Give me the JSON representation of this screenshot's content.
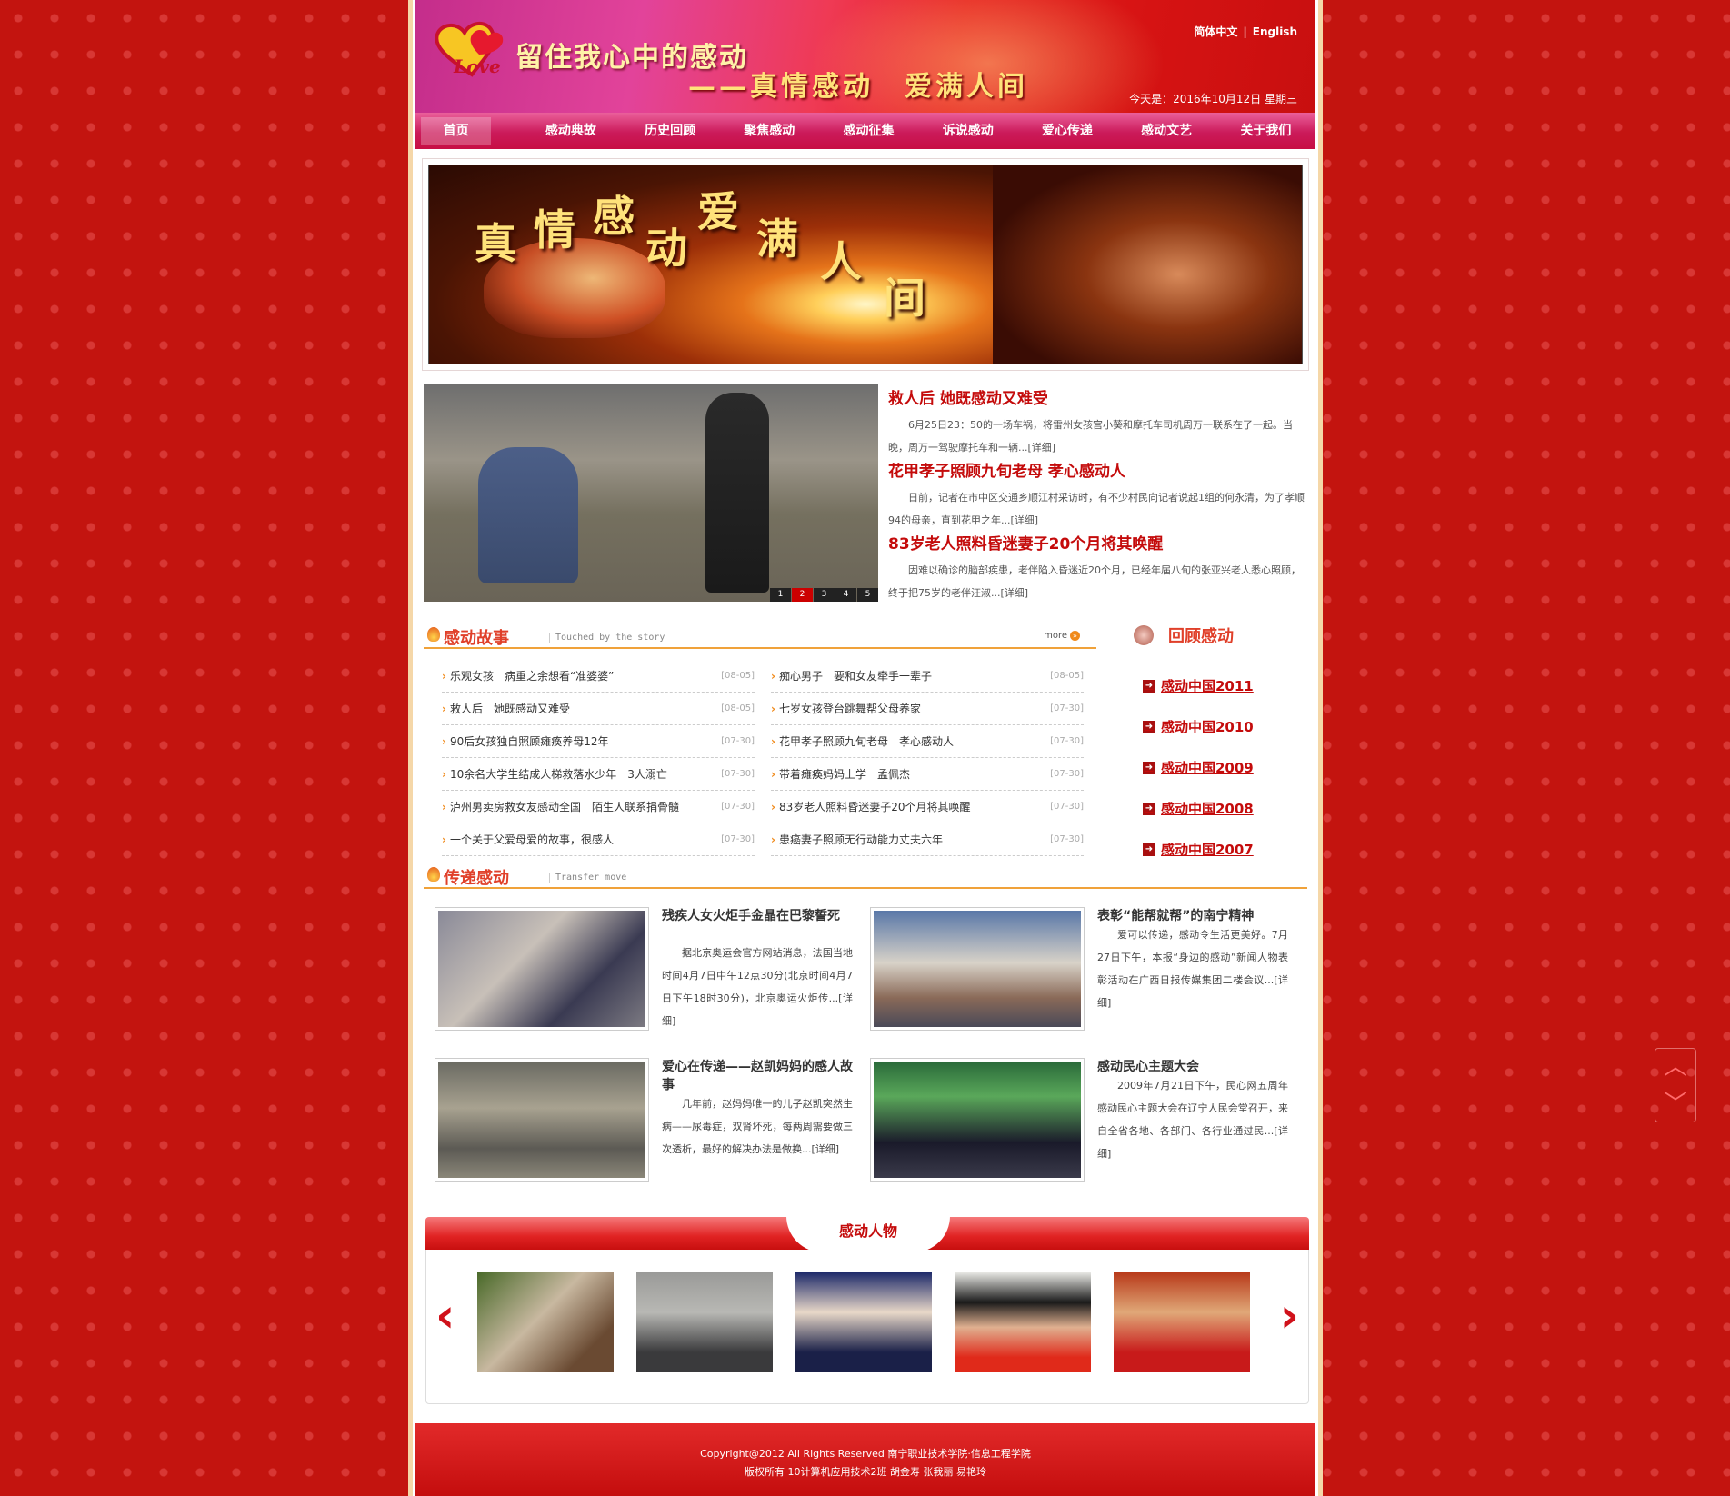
{
  "header": {
    "slogan_line1": "留住我心中的感动",
    "slogan_line2": "——真情感动　爱满人间",
    "lang_cn": "简体中文",
    "lang_sep": "|",
    "lang_en": "English",
    "today": "今天是：2016年10月12日 星期三"
  },
  "nav": [
    "首页",
    "感动典故",
    "历史回顾",
    "聚焦感动",
    "感动征集",
    "诉说感动",
    "爱心传递",
    "感动文艺",
    "关于我们"
  ],
  "banner": {
    "chars": [
      "真",
      "情",
      "感",
      "动",
      "爱",
      "满",
      "人",
      "间"
    ]
  },
  "feature": {
    "pager": [
      "1",
      "2",
      "3",
      "4",
      "5"
    ],
    "items": [
      {
        "title": "救人后 她既感动又难受",
        "text": "6月25日23：50的一场车祸，将雷州女孩宫小葵和摩托车司机周万一联系在了一起。当晚，周万一驾驶摩托车和一辆...",
        "more": "[详细]"
      },
      {
        "title": "花甲孝子照顾九旬老母 孝心感动人",
        "text": "日前，记者在市中区交通乡顺江村采访时，有不少村民向记者说起1组的何永清，为了孝顺94的母亲，直到花甲之年...",
        "more": "[详细]"
      },
      {
        "title": "83岁老人照料昏迷妻子20个月将其唤醒",
        "text": "因难以确诊的脑部疾患，老伴陷入昏迷近20个月，已经年届八旬的张亚兴老人悉心照顾，终于把75岁的老伴汪淑...",
        "more": "[详细]"
      }
    ]
  },
  "stories_section": {
    "title": "感动故事",
    "en": "Touched by the story",
    "more": "more"
  },
  "stories": [
    {
      "t": "乐观女孩　病重之余想看“准婆婆”",
      "d": "[08-05]"
    },
    {
      "t": "痴心男子　要和女友牵手一辈子",
      "d": "[08-05]"
    },
    {
      "t": "救人后　她既感动又难受",
      "d": "[08-05]"
    },
    {
      "t": "七岁女孩登台跳舞帮父母养家",
      "d": "[07-30]"
    },
    {
      "t": "90后女孩独自照顾瘫痪养母12年",
      "d": "[07-30]"
    },
    {
      "t": "花甲孝子照顾九旬老母　孝心感动人",
      "d": "[07-30]"
    },
    {
      "t": "10余名大学生结成人梯救落水少年　3人溺亡",
      "d": "[07-30]"
    },
    {
      "t": "带着瘫痪妈妈上学　孟佩杰",
      "d": "[07-30]"
    },
    {
      "t": "泸州男卖房救女友感动全国　陌生人联系捐骨髓",
      "d": "[07-30]"
    },
    {
      "t": "83岁老人照料昏迷妻子20个月将其唤醒",
      "d": "[07-30]"
    },
    {
      "t": "一个关于父爱母爱的故事，很感人",
      "d": "[07-30]"
    },
    {
      "t": "患癌妻子照顾无行动能力丈夫六年",
      "d": "[07-30]"
    }
  ],
  "review": {
    "title": "回顾感动",
    "items": [
      "感动中国2011",
      "感动中国2010",
      "感动中国2009",
      "感动中国2008",
      "感动中国2007"
    ]
  },
  "transfer_section": {
    "title": "传递感动",
    "en": "Transfer move"
  },
  "transfer": [
    {
      "title": "残疾人女火炬手金晶在巴黎誓死",
      "text": "据北京奥运会官方网站消息，法国当地时间4月7日中午12点30分(北京时间4月7日下午18时30分)，北京奥运火炬传...",
      "more": "[详细]"
    },
    {
      "title": "表彰“能帮就帮”的南宁精神",
      "text": "爱可以传递，感动令生活更美好。7月27日下午，本报“身边的感动”新闻人物表彰活动在广西日报传媒集团二楼会议...",
      "more": "[详细]"
    },
    {
      "title": "爱心在传递——赵凯妈妈的感人故事",
      "text": "几年前，赵妈妈唯一的儿子赵凯突然生病——尿毒症，双肾坏死，每两周需要做三次透析，最好的解决办法是做换...",
      "more": "[详细]"
    },
    {
      "title": "感动民心主题大会",
      "text": "2009年7月21日下午，民心网五周年感动民心主题大会在辽宁人民会堂召开，来自全省各地、各部门、各行业通过民...",
      "more": "[详细]"
    }
  ],
  "persons": {
    "title": "感动人物"
  },
  "footer": {
    "line1": "Copyright@2012 All Rights Reserved 南宁职业技术学院·信息工程学院",
    "line2": "版权所有 10计算机应用技术2班 胡金寿 张我丽 易艳玲"
  }
}
